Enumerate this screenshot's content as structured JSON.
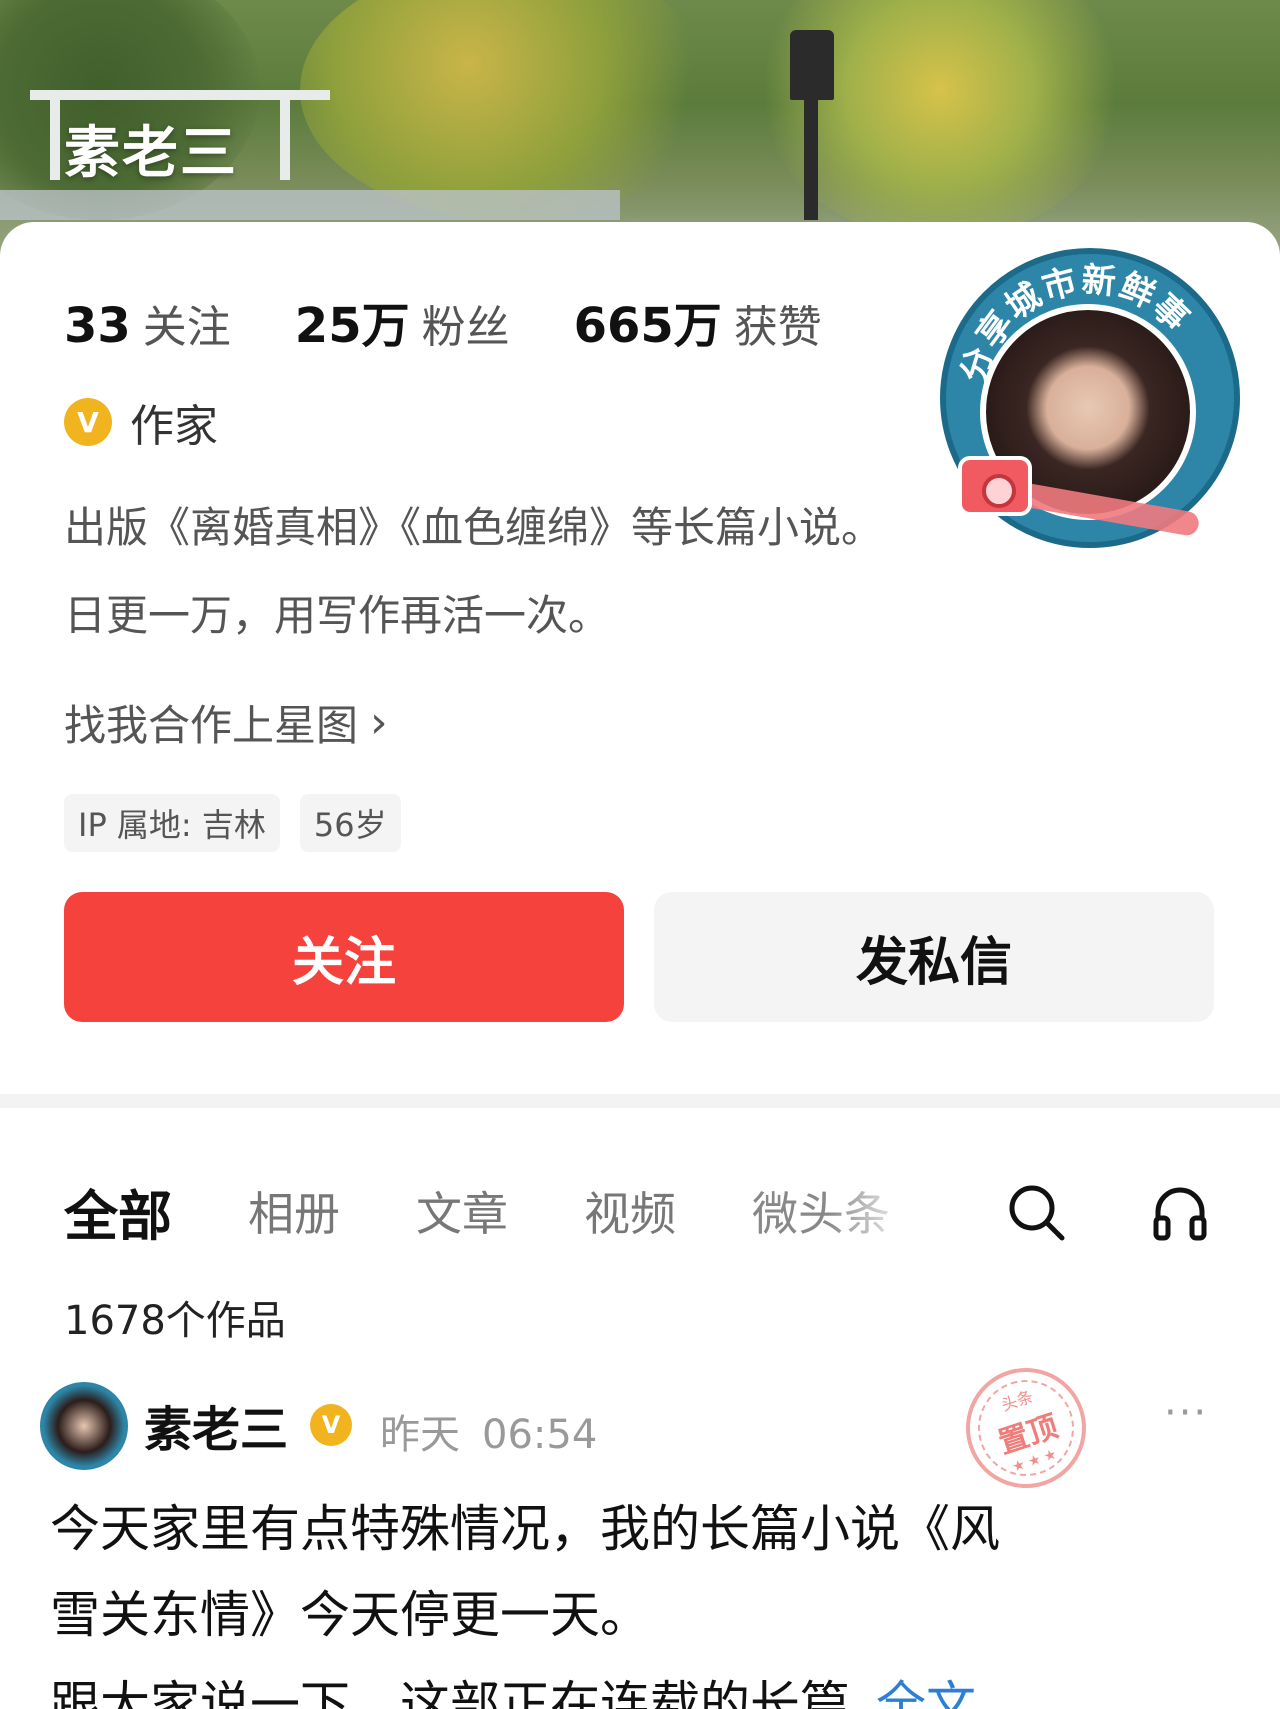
{
  "banner": {
    "name": "素老三"
  },
  "avatar": {
    "frame_text": "分享城市新鲜事"
  },
  "stats": [
    {
      "num": "33",
      "label": "关注"
    },
    {
      "num": "25万",
      "label": "粉丝"
    },
    {
      "num": "665万",
      "label": "获赞"
    }
  ],
  "verify": {
    "badge": "V",
    "text": "作家"
  },
  "bio": {
    "line1": "出版《离婚真相》《血色缠绵》等长篇小说。",
    "line2": "日更一万，用写作再活一次。"
  },
  "coop": {
    "label": "找我合作上星图",
    "chevron": "›"
  },
  "tags": [
    "IP 属地: 吉林",
    "56岁"
  ],
  "buttons": {
    "follow": "关注",
    "message": "发私信"
  },
  "tabs": [
    "全部",
    "相册",
    "文章",
    "视频",
    "微头条"
  ],
  "tab_icons": [
    "search-icon",
    "headphones-icon"
  ],
  "works_count": "1678个作品",
  "post": {
    "author": "素老三",
    "badge": "V",
    "day": "昨天",
    "time": "06:54",
    "pin_small": "头条",
    "pin_label": "置顶",
    "pin_dots": "★★★",
    "more": "···",
    "line1": "今天家里有点特殊情况，我的长篇小说《风",
    "line2": "雪关东情》今天停更一天。",
    "line3": "跟大家说一下，这部正在连载的长篇",
    "fulltext": "全文"
  },
  "colors": {
    "follow_button": "#f5423d",
    "verify_badge": "#f2b41e",
    "link": "#2d7fd6"
  }
}
